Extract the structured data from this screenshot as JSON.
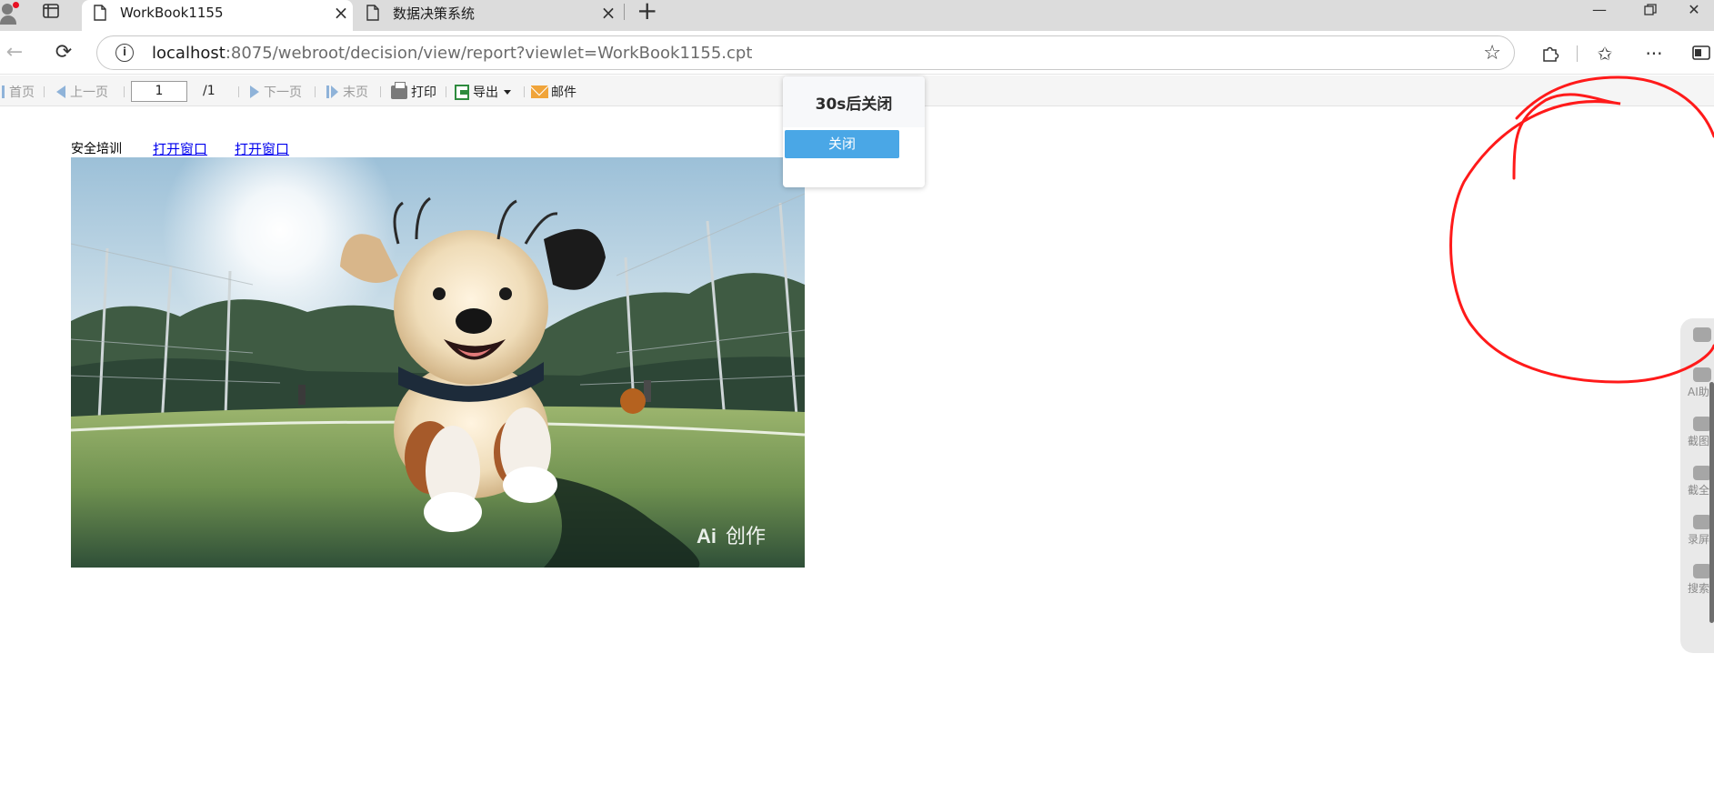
{
  "browser": {
    "tabs": [
      {
        "title": "WorkBook1155",
        "active": true
      },
      {
        "title": "数据决策系统",
        "active": false
      }
    ],
    "url_host": "localhost",
    "url_rest": ":8075/webroot/decision/view/report?viewlet=WorkBook1155.cpt",
    "colors": {
      "tabstrip": "#dcdcdc",
      "accent_notification": "#e81123"
    },
    "icons": {
      "profile": "profile-avatar-icon",
      "tab_actions": "tab-actions-icon",
      "document": "document-icon",
      "close": "close-icon",
      "new_tab": "plus-icon",
      "back": "back-arrow-icon",
      "reload": "reload-icon",
      "info": "info-icon",
      "favorite": "star-icon",
      "extensions": "puzzle-icon",
      "favorites_list": "favorites-icon",
      "more": "more-icon",
      "sidebar": "sidebar-toggle-icon"
    }
  },
  "report_toolbar": {
    "first_page": "首页",
    "prev_page": "上一页",
    "current_page": "1",
    "total_pages": "/1",
    "next_page": "下一页",
    "last_page": "末页",
    "print": "打印",
    "export": "导出",
    "mail": "邮件"
  },
  "report": {
    "label": "安全培训",
    "link1": "打开窗口",
    "link2": "打开窗口",
    "image_watermark": "创作",
    "image_watermark_logo": "Ai",
    "image_subject": "dog-running-on-tennis-court"
  },
  "popup": {
    "countdown_text": "30s后关闭",
    "close_button": "关闭",
    "colors": {
      "button": "#4aa7e6"
    }
  },
  "side_panel": {
    "items": [
      "AI助手",
      "截图",
      "截全屏",
      "录屏",
      "搜索"
    ]
  },
  "annotation": {
    "color": "#ff1a1a",
    "shape": "hand-drawn-circle"
  }
}
